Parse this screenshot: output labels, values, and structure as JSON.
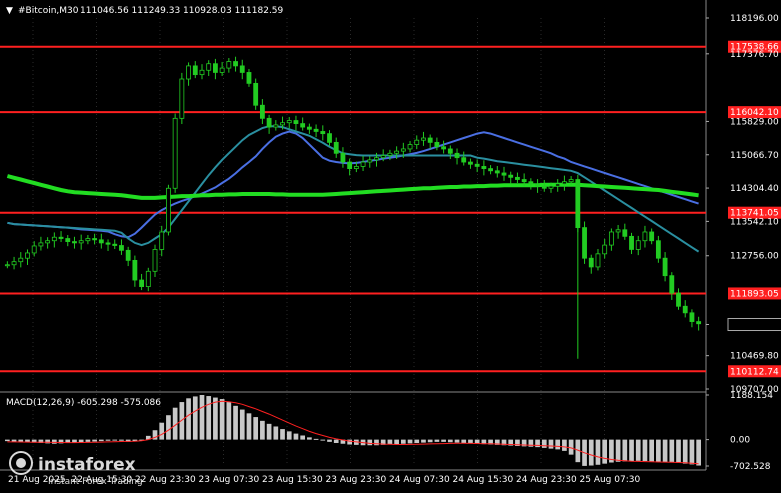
{
  "chart_data": {
    "type": "candlestick",
    "symbol": "#Bitcoin,M30",
    "ohlc_header": "111046.56 111249.33 110928.03 111182.59",
    "price_scale": {
      "ticks": [
        "118196.00",
        "117376.70",
        "115829.00",
        "115066.70",
        "114304.40",
        "113542.10",
        "112756.00",
        "111182.59",
        "110469.80",
        "109707.00"
      ],
      "ylim": [
        109707.0,
        118196.0
      ]
    },
    "levels": [
      {
        "label": "117538.66",
        "value": 117538.66,
        "color": "#ff2020"
      },
      {
        "label": "116042.10",
        "value": 116042.1,
        "color": "#ff2020"
      },
      {
        "label": "113741.05",
        "value": 113741.05,
        "color": "#ff2020"
      },
      {
        "label": "111893.05",
        "value": 111893.05,
        "color": "#ff2020"
      },
      {
        "label": "110112.74",
        "value": 110112.74,
        "color": "#ff2020"
      }
    ],
    "last_price": "111182.59",
    "time_axis": {
      "labels": [
        "21 Aug 2025",
        "22 Aug 15:30",
        "22 Aug 23:30",
        "23 Aug 07:30",
        "23 Aug 15:30",
        "23 Aug 23:30",
        "24 Aug 07:30",
        "24 Aug 15:30",
        "24 Aug 23:30",
        "25 Aug 07:30"
      ]
    },
    "close_series": [
      112550,
      112620,
      112700,
      112820,
      112980,
      113050,
      113100,
      113180,
      113150,
      113080,
      113050,
      113100,
      113150,
      113120,
      113050,
      113020,
      112990,
      112880,
      112650,
      112200,
      112050,
      112400,
      112900,
      113300,
      114300,
      115900,
      116800,
      117100,
      116900,
      117000,
      117150,
      116950,
      117050,
      117200,
      117100,
      116950,
      116700,
      116200,
      115900,
      115700,
      115750,
      115800,
      115850,
      115780,
      115700,
      115650,
      115600,
      115550,
      115350,
      115100,
      114900,
      114750,
      114800,
      114900,
      114950,
      115000,
      115050,
      115100,
      115150,
      115200,
      115300,
      115400,
      115450,
      115350,
      115250,
      115200,
      115100,
      115000,
      114900,
      114850,
      114800,
      114750,
      114700,
      114650,
      114600,
      114550,
      114500,
      114450,
      114400,
      114350,
      114300,
      114350,
      114400,
      114450,
      114500,
      113400,
      112700,
      112500,
      112800,
      113000,
      113300,
      113350,
      113200,
      112900,
      113100,
      113300,
      113100,
      112700,
      112300,
      111900,
      111600,
      111450,
      111250,
      111200
    ],
    "ma_series": [
      {
        "name": "MA fast",
        "color": "#4a6fe3",
        "values": [
          113510,
          113480,
          113470,
          113460,
          113450,
          113440,
          113430,
          113420,
          113410,
          113400,
          113380,
          113360,
          113350,
          113340,
          113330,
          113310,
          113250,
          113200,
          113180,
          113260,
          113400,
          113550,
          113700,
          113800,
          113880,
          113950,
          114010,
          114060,
          114120,
          114180,
          114250,
          114320,
          114420,
          114520,
          114640,
          114780,
          114900,
          115030,
          115200,
          115350,
          115480,
          115550,
          115600,
          115550,
          115450,
          115300,
          115150,
          115000,
          114930,
          114900,
          114880,
          114870,
          114880,
          114900,
          114930,
          114950,
          114980,
          115000,
          115020,
          115050,
          115080,
          115110,
          115150,
          115200,
          115250,
          115300,
          115350,
          115400,
          115450,
          115500,
          115550,
          115580,
          115550,
          115500,
          115450,
          115400,
          115350,
          115300,
          115250,
          115200,
          115150,
          115100,
          115030,
          114980,
          114900,
          114850,
          114800,
          114750,
          114700,
          114650,
          114600,
          114550,
          114500,
          114450,
          114400,
          114350,
          114300,
          114250,
          114200,
          114150,
          114100,
          114050,
          114000,
          113950
        ]
      },
      {
        "name": "MA medium",
        "color": "#2a8fa0",
        "values": [
          113510,
          113480,
          113470,
          113460,
          113450,
          113440,
          113430,
          113420,
          113410,
          113400,
          113390,
          113380,
          113370,
          113360,
          113350,
          113340,
          113330,
          113280,
          113150,
          113050,
          113000,
          113050,
          113150,
          113250,
          113400,
          113600,
          113800,
          114000,
          114200,
          114400,
          114600,
          114780,
          114950,
          115100,
          115250,
          115400,
          115520,
          115600,
          115680,
          115720,
          115720,
          115700,
          115650,
          115600,
          115550,
          115500,
          115420,
          115340,
          115250,
          115170,
          115100,
          115080,
          115060,
          115050,
          115050,
          115050,
          115050,
          115050,
          115050,
          115050,
          115050,
          115050,
          115050,
          115050,
          115050,
          115050,
          115050,
          115050,
          115050,
          115050,
          115000,
          114980,
          114950,
          114920,
          114900,
          114880,
          114860,
          114840,
          114820,
          114800,
          114780,
          114760,
          114740,
          114720,
          114700,
          114650,
          114550,
          114450,
          114350,
          114250,
          114150,
          114050,
          113950,
          113850,
          113750,
          113650,
          113550,
          113450,
          113350,
          113250,
          113150,
          113050,
          112950,
          112850
        ]
      },
      {
        "name": "MA slow",
        "color": "#22dd22",
        "values": [
          114580,
          114540,
          114500,
          114460,
          114420,
          114380,
          114340,
          114300,
          114260,
          114230,
          114210,
          114200,
          114190,
          114180,
          114170,
          114160,
          114150,
          114140,
          114120,
          114100,
          114080,
          114080,
          114080,
          114090,
          114100,
          114110,
          114120,
          114120,
          114130,
          114140,
          114140,
          114150,
          114150,
          114160,
          114160,
          114170,
          114170,
          114170,
          114170,
          114170,
          114160,
          114160,
          114150,
          114150,
          114150,
          114150,
          114150,
          114150,
          114160,
          114170,
          114180,
          114190,
          114200,
          114210,
          114220,
          114230,
          114240,
          114250,
          114260,
          114270,
          114280,
          114290,
          114300,
          114300,
          114310,
          114320,
          114330,
          114330,
          114340,
          114340,
          114350,
          114350,
          114360,
          114360,
          114370,
          114370,
          114370,
          114370,
          114370,
          114370,
          114380,
          114380,
          114380,
          114380,
          114380,
          114380,
          114370,
          114360,
          114350,
          114340,
          114330,
          114320,
          114310,
          114300,
          114290,
          114280,
          114270,
          114260,
          114240,
          114220,
          114200,
          114180,
          114160,
          114140
        ]
      }
    ],
    "macd": {
      "label": "MACD(12,26,9) -605.298 -575.086",
      "ticks": [
        "1188.154",
        "0.00",
        "-702.528"
      ],
      "ylim": [
        -702.528,
        1188.154
      ],
      "histogram": [
        -40,
        -50,
        -60,
        -70,
        -80,
        -90,
        -100,
        -110,
        -100,
        -90,
        -80,
        -70,
        -60,
        -50,
        -40,
        -30,
        -20,
        -30,
        -60,
        -50,
        0,
        100,
        250,
        450,
        650,
        850,
        1000,
        1100,
        1150,
        1188,
        1160,
        1120,
        1080,
        1000,
        900,
        800,
        700,
        600,
        500,
        420,
        350,
        280,
        220,
        160,
        110,
        60,
        20,
        -20,
        -60,
        -90,
        -110,
        -130,
        -140,
        -150,
        -150,
        -150,
        -140,
        -130,
        -120,
        -110,
        -100,
        -90,
        -80,
        -70,
        -60,
        -60,
        -70,
        -80,
        -90,
        -100,
        -110,
        -120,
        -130,
        -140,
        -150,
        -160,
        -170,
        -180,
        -190,
        -200,
        -220,
        -240,
        -260,
        -300,
        -400,
        -600,
        -700,
        -690,
        -670,
        -640,
        -610,
        -590,
        -580,
        -570,
        -565,
        -570,
        -580,
        -590,
        -600,
        -610,
        -620,
        -640,
        -660,
        -690
      ],
      "signal": [
        -60,
        -62,
        -64,
        -66,
        -68,
        -70,
        -72,
        -75,
        -78,
        -80,
        -80,
        -78,
        -75,
        -70,
        -65,
        -60,
        -55,
        -50,
        -48,
        -45,
        -30,
        0,
        60,
        140,
        250,
        380,
        520,
        650,
        760,
        860,
        940,
        1000,
        1020,
        1010,
        980,
        940,
        880,
        820,
        750,
        680,
        600,
        520,
        440,
        360,
        290,
        220,
        160,
        110,
        60,
        20,
        -10,
        -40,
        -60,
        -80,
        -100,
        -110,
        -120,
        -125,
        -130,
        -130,
        -128,
        -125,
        -120,
        -115,
        -110,
        -105,
        -100,
        -98,
        -98,
        -100,
        -104,
        -108,
        -112,
        -118,
        -124,
        -130,
        -136,
        -142,
        -148,
        -155,
        -162,
        -170,
        -180,
        -195,
        -220,
        -280,
        -350,
        -410,
        -460,
        -500,
        -530,
        -550,
        -565,
        -575,
        -580,
        -585,
        -590,
        -595,
        -600,
        -605,
        -610,
        -618,
        -628,
        -640
      ]
    }
  },
  "watermark": {
    "brand": "instaforex",
    "tagline": "Instant Forex Trading"
  },
  "colors": {
    "background": "#000000",
    "bull": "#22cc22",
    "bear": "#22cc22",
    "levels": "#ff2020",
    "grid": "#3a3a3a"
  }
}
